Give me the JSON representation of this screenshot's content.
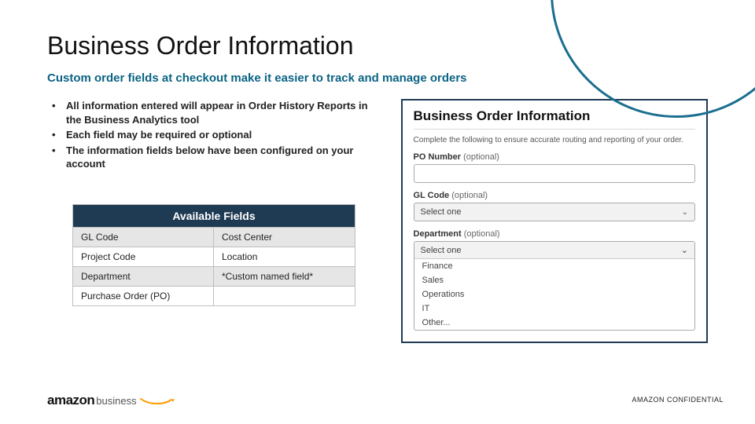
{
  "header": {
    "title": "Business Order Information",
    "subtitle": "Custom order fields at checkout make it easier to track and manage orders"
  },
  "bullets": [
    "All information entered will appear in Order History Reports in the Business Analytics tool",
    "Each field may be required or optional",
    "The information fields below have been configured on your account"
  ],
  "table": {
    "header": "Available Fields",
    "rows": [
      [
        "GL Code",
        "Cost Center"
      ],
      [
        "Project Code",
        "Location"
      ],
      [
        "Department",
        "*Custom named field*"
      ],
      [
        "Purchase Order (PO)",
        ""
      ]
    ]
  },
  "panel": {
    "title": "Business Order Information",
    "description": "Complete the following to ensure accurate routing and reporting of your order.",
    "po_label": "PO Number",
    "optional": "(optional)",
    "gl_label": "GL Code",
    "gl_value": "Select one",
    "dept_label": "Department",
    "dept_value": "Select one",
    "options": [
      "Finance",
      "Sales",
      "Operations",
      "IT",
      "Other..."
    ]
  },
  "footer": {
    "brand1": "amazon",
    "brand2": "business",
    "conf": "AMAZON CONFIDENTIAL"
  }
}
